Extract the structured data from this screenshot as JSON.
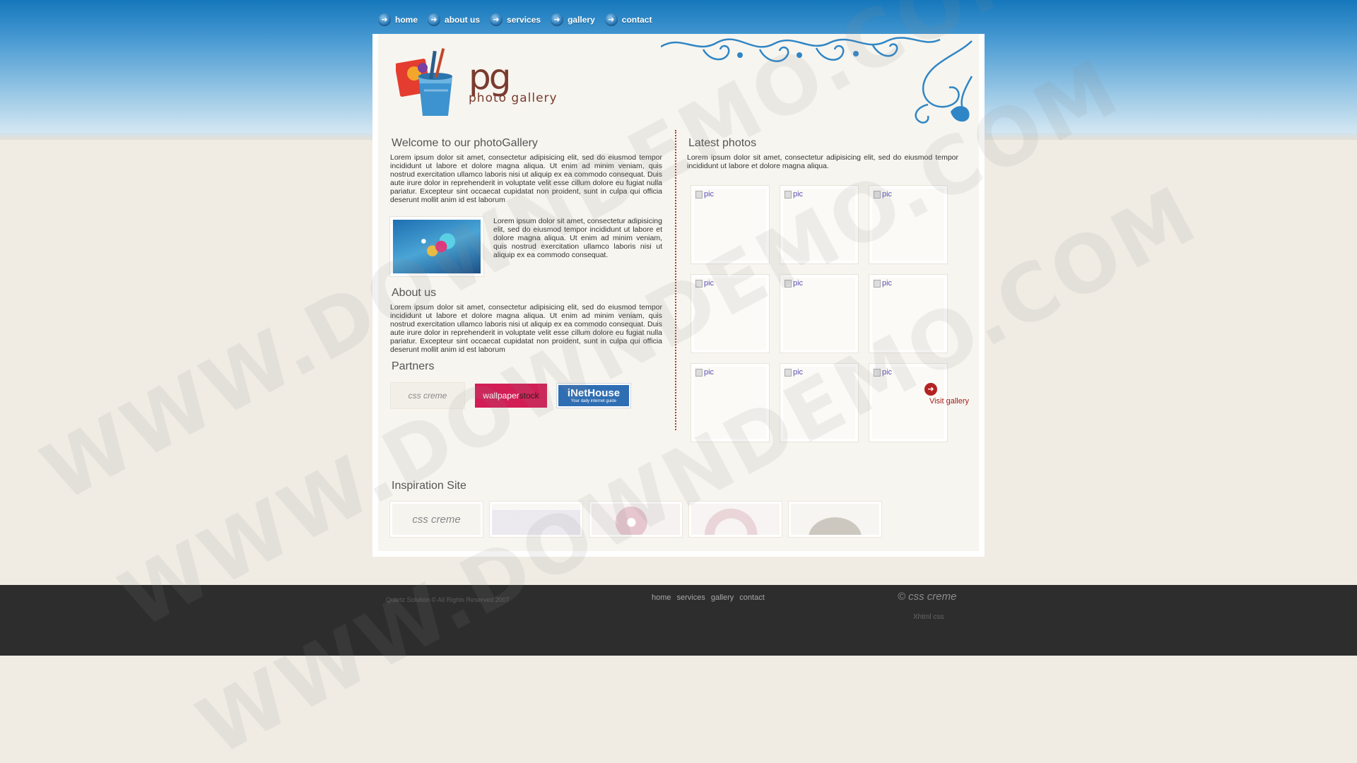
{
  "nav": {
    "items": [
      {
        "label": "home",
        "icon": "arrow-right-icon"
      },
      {
        "label": "about us",
        "icon": "arrow-right-icon"
      },
      {
        "label": "services",
        "icon": "arrow-right-icon"
      },
      {
        "label": "gallery",
        "icon": "arrow-right-icon"
      },
      {
        "label": "contact",
        "icon": "arrow-right-icon"
      }
    ]
  },
  "header": {
    "logo_main": "pg",
    "logo_sub": "photo gallery"
  },
  "welcome": {
    "title": "Welcome to our photoGallery",
    "text": "Lorem ipsum dolor sit amet, consectetur adipisicing elit, sed do eiusmod tempor incididunt ut labore et dolore magna aliqua. Ut enim ad minim veniam, quis nostrud exercitation ullamco laboris nisi ut aliquip ex ea commodo consequat. Duis aute irure dolor in reprehenderit in voluptate velit esse cillum dolore eu fugiat nulla pariatur. Excepteur sint occaecat cupidatat non proident, sunt in culpa qui officia deserunt mollit anim id est laborum",
    "feature_text": "Lorem ipsum dolor sit amet, consectetur adipisicing elit, sed do eiusmod tempor incididunt ut labore et dolore magna aliqua. Ut enim ad minim veniam, quis nostrud exercitation ullamco laboris nisi ut aliquip ex ea commodo consequat."
  },
  "about": {
    "title": "About us",
    "text": "Lorem ipsum dolor sit amet, consectetur adipisicing elit, sed do eiusmod tempor incididunt ut labore et dolore magna aliqua. Ut enim ad minim veniam, quis nostrud exercitation ullamco laboris nisi ut aliquip ex ea commodo consequat. Duis aute irure dolor in reprehenderit in voluptate velit esse cillum dolore eu fugiat nulla pariatur. Excepteur sint occaecat cupidatat non proident, sunt in culpa qui officia deserunt mollit anim id est laborum"
  },
  "partners": {
    "title": "Partners",
    "items": [
      {
        "name": "css creme"
      },
      {
        "name_part1": "wallpaper",
        "name_part2": "stock"
      },
      {
        "name": "iNetHouse",
        "tagline": "Your daily internet guide"
      }
    ]
  },
  "latest": {
    "title": "Latest photos",
    "text": "Lorem ipsum dolor sit amet, consectetur adipisicing elit, sed do eiusmod tempor incididunt ut labore et dolore magna aliqua.",
    "thumbs": [
      "pic",
      "pic",
      "pic",
      "pic",
      "pic",
      "pic",
      "pic",
      "pic",
      "pic"
    ],
    "visit_label": "Visit gallery"
  },
  "inspiration": {
    "title": "Inspiration Site",
    "first_label": "css creme"
  },
  "footer": {
    "copyright": "Quartz Solution © All Rights Reserved 2007",
    "links": [
      "home",
      "services",
      "gallery",
      "contact"
    ],
    "logo_text": "css creme",
    "sub_text": "Xhtml css"
  },
  "watermark": "WWW.DOWNDEMO.COM",
  "colors": {
    "accent_blue": "#1577bb",
    "brand_brown": "#7a3b2e",
    "link_red": "#a31d1d",
    "footer_bg": "#2d2d2d"
  }
}
